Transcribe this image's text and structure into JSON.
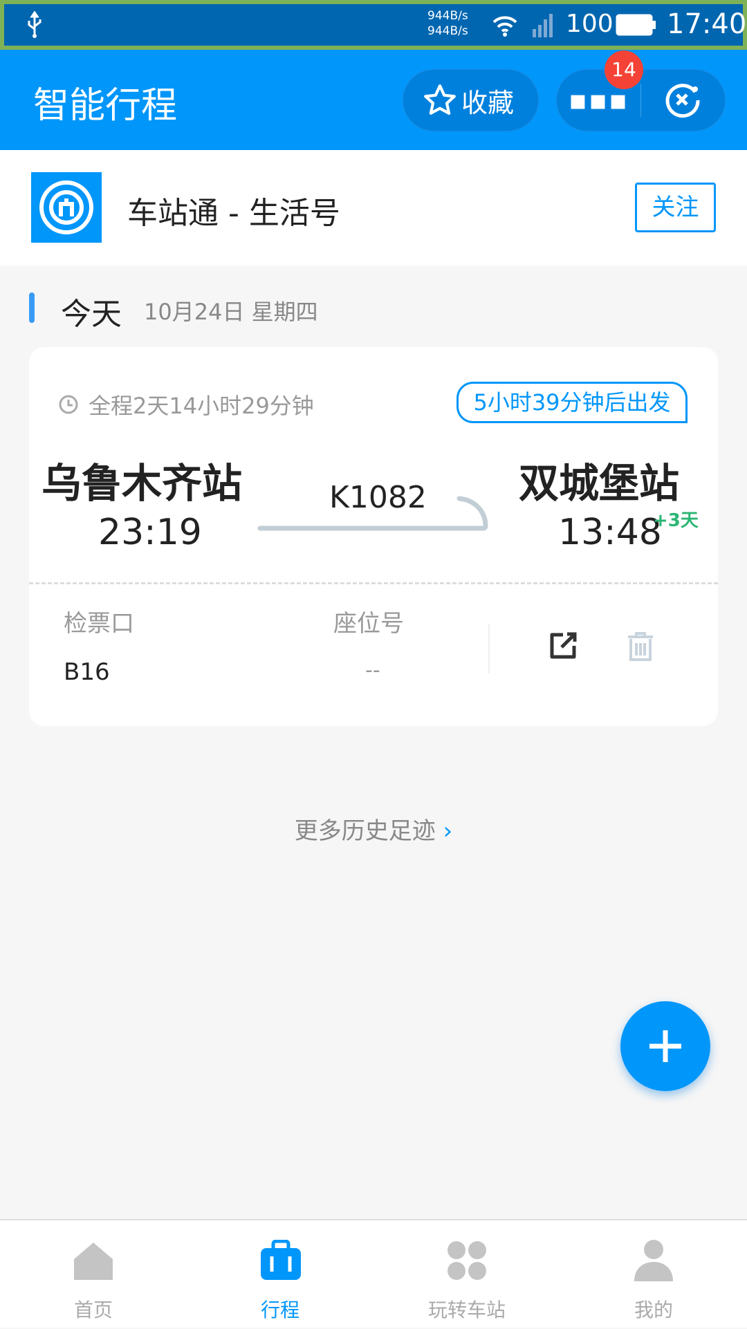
{
  "status_bar": {
    "net_up": "944B/s",
    "net_down": "944B/s",
    "battery": "100",
    "time": "17:40"
  },
  "header": {
    "title": "智能行程",
    "favorite_label": "收藏",
    "badge_count": "14"
  },
  "profile": {
    "name": "车站通 - 生活号",
    "follow_label": "关注"
  },
  "today": {
    "label": "今天",
    "date": "10月24日 星期四"
  },
  "trip": {
    "duration": "全程2天14小时29分钟",
    "countdown": "5小时39分钟后出发",
    "from_station": "乌鲁木齐站",
    "from_time": "23:19",
    "train": "K1082",
    "to_station": "双城堡站",
    "to_time": "13:48",
    "day_offset": "+3天",
    "gate_label": "检票口",
    "gate_value": "B16",
    "seat_label": "座位号",
    "seat_value": "--"
  },
  "more_history": "更多历史足迹",
  "bottom_nav": [
    {
      "label": "首页"
    },
    {
      "label": "行程"
    },
    {
      "label": "玩转车站"
    },
    {
      "label": "我的"
    }
  ],
  "colors": {
    "primary": "#0096fa",
    "badge": "#f44336",
    "green": "#2bb673"
  }
}
